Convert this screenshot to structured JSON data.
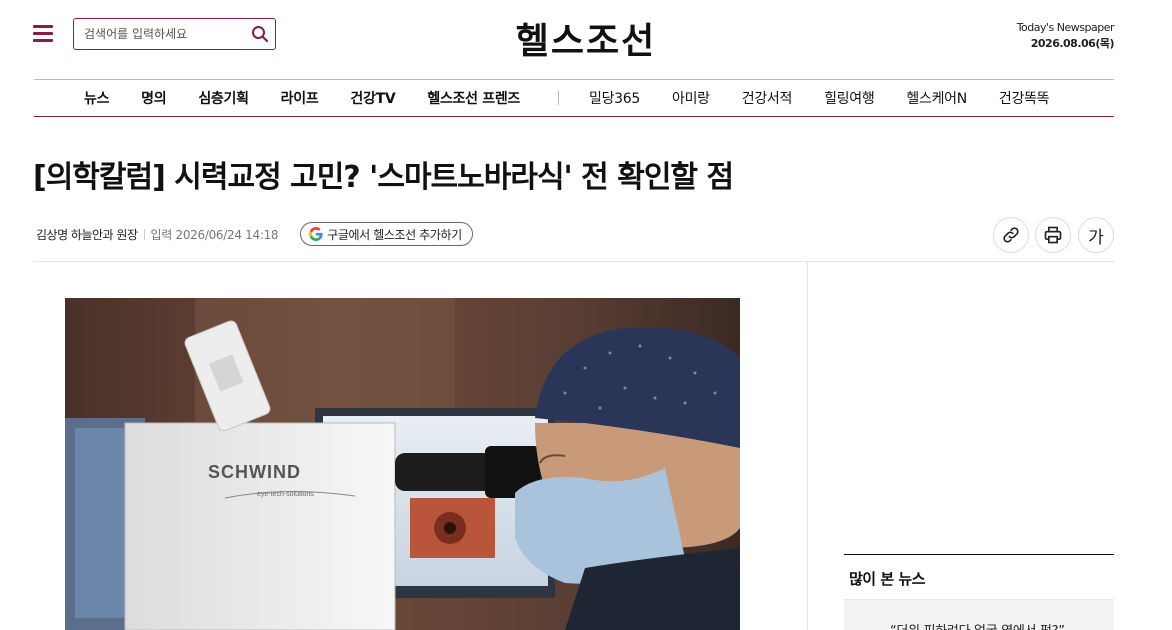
{
  "header": {
    "search_placeholder": "검색어를 입력하세요",
    "logo": "헬스조선",
    "newspaper_label": "Today's Newspaper",
    "newspaper_date": "2026.08.06(목)"
  },
  "nav": {
    "primary": [
      "뉴스",
      "명의",
      "심층기획",
      "라이프",
      "건강TV",
      "헬스조선 프렌즈"
    ],
    "secondary": [
      "밀당365",
      "아미랑",
      "건강서적",
      "힐링여행",
      "헬스케어N",
      "건강똑똑"
    ]
  },
  "article": {
    "title": "[의학칼럼] 시력교정 고민? '스마트노바라식' 전 확인할 점",
    "author": "김상명 하늘안과 원장",
    "published": "입력 2026/06/24 14:18",
    "google_button_label": "구글에서 헬스조선 추가하기",
    "photo_text": {
      "brand": "SCHWIND",
      "tagline": "eye-tech-solutions"
    }
  },
  "tools": {
    "font_button_label": "가",
    "icons": [
      "link-icon",
      "print-icon"
    ]
  },
  "sidebar": {
    "popular_title": "많이 본 뉴스",
    "popular_items": [
      "“더위 피하려다 얼굴 옆에서 펑?”…"
    ]
  },
  "colors": {
    "accent": "#8a1c48",
    "text": "#111111",
    "muted": "#777777"
  }
}
